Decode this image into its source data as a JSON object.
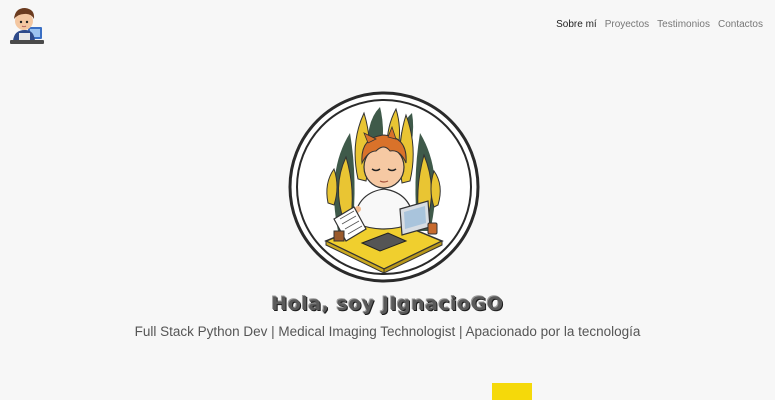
{
  "nav": {
    "logo_icon": "developer-avatar-icon",
    "links": [
      {
        "label": "Sobre mí",
        "active": true
      },
      {
        "label": "Proyectos",
        "active": false
      },
      {
        "label": "Testimonios",
        "active": false
      },
      {
        "label": "Contactos",
        "active": false
      }
    ]
  },
  "hero": {
    "avatar_icon": "developer-at-desk-illustration",
    "title": "Hola, soy JIgnacioGO",
    "subtitle": "Full Stack Python Dev | Medical Imaging Technologist | Apacionado por la tecnología"
  },
  "colors": {
    "background": "#f7f7f7",
    "accent_yellow": "#f5d90a",
    "nav_active": "#222222",
    "nav_inactive": "#777777"
  }
}
